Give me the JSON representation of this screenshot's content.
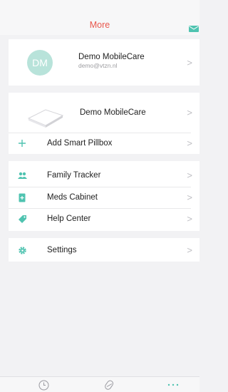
{
  "header": {
    "title": "More",
    "mail_icon": "mail-icon"
  },
  "profile": {
    "initials": "DM",
    "name": "Demo MobileCare",
    "email": "demo@vtzn.nl"
  },
  "device": {
    "name": "Demo MobileCare",
    "add_label": "Add Smart Pillbox"
  },
  "menu": {
    "items": [
      {
        "label": "Family Tracker",
        "icon": "people-icon"
      },
      {
        "label": "Meds Cabinet",
        "icon": "cabinet-icon"
      },
      {
        "label": "Help Center",
        "icon": "tag-icon"
      }
    ]
  },
  "settings": {
    "label": "Settings",
    "icon": "gear-icon"
  },
  "tabbar": {
    "tabs": [
      {
        "name": "history",
        "icon": "clock-icon"
      },
      {
        "name": "pills",
        "icon": "pill-icon"
      },
      {
        "name": "more",
        "icon": "ellipsis-icon"
      }
    ]
  },
  "colors": {
    "accent": "#e8574c",
    "teal": "#4fc3b0",
    "avatar_bg": "#b8e3da"
  }
}
